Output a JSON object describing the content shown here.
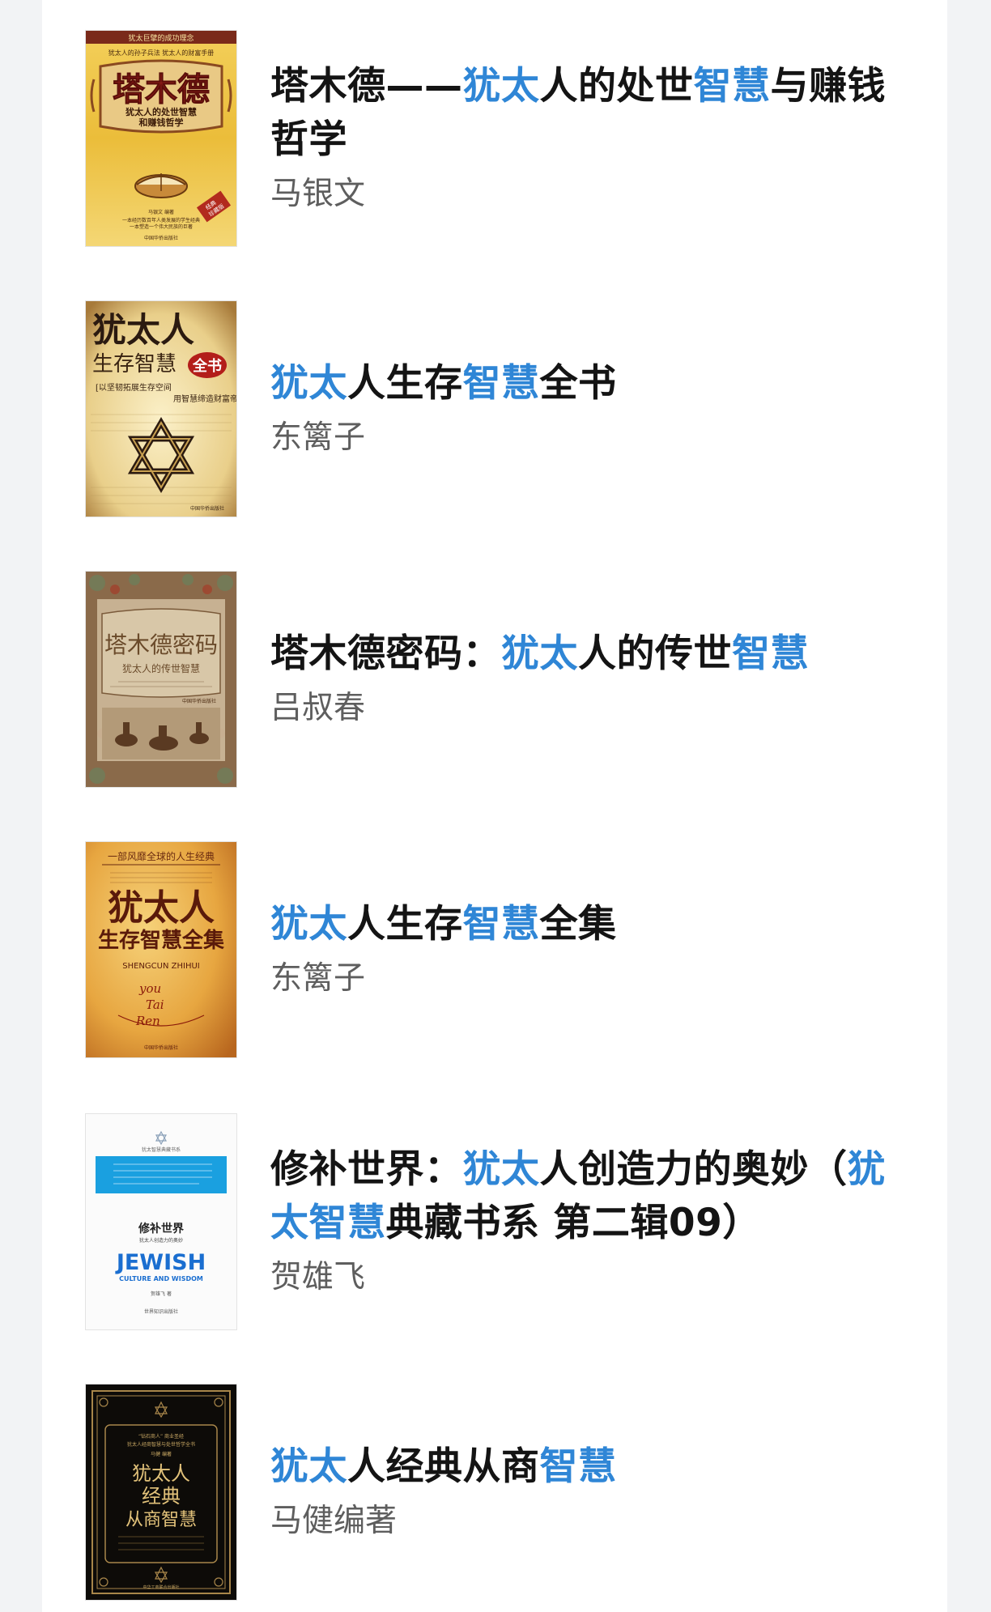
{
  "colors": {
    "highlight": "#2f86d6",
    "title": "#141414",
    "author": "#5e5e5e"
  },
  "results": [
    {
      "title_parts": [
        {
          "t": "塔木德——",
          "hl": false
        },
        {
          "t": "犹太",
          "hl": true
        },
        {
          "t": "人的处世",
          "hl": false
        },
        {
          "t": "智慧",
          "hl": true
        },
        {
          "t": "与赚钱哲学",
          "hl": false
        }
      ],
      "author": "马银文",
      "cover": {
        "top_line": "犹太巨擘的成功理念",
        "sub_line": "犹太人的孙子兵法  犹太人的财富手册",
        "main_title": "塔木德",
        "sub_title_1": "犹太人的处世智慧",
        "sub_title_2": "和赚钱哲学",
        "badge_1": "经典",
        "badge_2": "珍藏版",
        "author_line": "马银文 编著",
        "blurb_1": "一本经历数百年人类发展的学生经典",
        "blurb_2": "一本塑造一个伟大民族的巨著",
        "publisher": "中国华侨出版社"
      }
    },
    {
      "title_parts": [
        {
          "t": "犹太",
          "hl": true
        },
        {
          "t": "人生存",
          "hl": false
        },
        {
          "t": "智慧",
          "hl": true
        },
        {
          "t": "全书",
          "hl": false
        }
      ],
      "author": "东篱子",
      "cover": {
        "main_title": "犹太人",
        "line_2": "生存智慧",
        "badge": "全书",
        "quote_1": "[以坚韧拓展生存空间",
        "quote_2": "用智慧缔造财富帝国]",
        "publisher": "中国华侨出版社"
      }
    },
    {
      "title_parts": [
        {
          "t": "塔木德密码：",
          "hl": false
        },
        {
          "t": "犹太",
          "hl": true
        },
        {
          "t": "人的传世",
          "hl": false
        },
        {
          "t": "智慧",
          "hl": true
        }
      ],
      "author": "吕叔春",
      "cover": {
        "main_title": "塔木德密码",
        "sub_title": "犹太人的传世智慧",
        "publisher": "中国华侨出版社"
      }
    },
    {
      "title_parts": [
        {
          "t": "犹太",
          "hl": true
        },
        {
          "t": "人生存",
          "hl": false
        },
        {
          "t": "智慧",
          "hl": true
        },
        {
          "t": "全集",
          "hl": false
        }
      ],
      "author": "东篱子",
      "cover": {
        "top_line": "一部风靡全球的人生经典",
        "main_title": "犹太人",
        "line_2": "生存智慧全集",
        "pinyin": "SHENGCUN ZHIHUI",
        "script_1": "you",
        "script_2": "Tai",
        "script_3": "Ren",
        "publisher": "中国华侨出版社"
      }
    },
    {
      "title_parts": [
        {
          "t": "修补世界：",
          "hl": false
        },
        {
          "t": "犹太",
          "hl": true
        },
        {
          "t": "人创造力的奥妙（",
          "hl": false
        },
        {
          "t": "犹太智慧",
          "hl": true
        },
        {
          "t": "典藏书系 第二辑09）",
          "hl": false
        }
      ],
      "author": "贺雄飞",
      "cover": {
        "series": "犹太智慧典藏书系",
        "main_title": "修补世界",
        "sub_title": "犹太人创造力的奥妙",
        "en_1": "JEWISH",
        "en_2": "CULTURE AND WISDOM",
        "author_line": "贺雄飞 著",
        "publisher": "世界知识出版社"
      }
    },
    {
      "title_parts": [
        {
          "t": "犹太",
          "hl": true
        },
        {
          "t": "人经典从商",
          "hl": false
        },
        {
          "t": "智慧",
          "hl": true
        }
      ],
      "author": "马健编著",
      "cover": {
        "top_1": "“钻石商人” 商业圣经",
        "top_2": "犹太人经商智慧与处世哲学全书",
        "author_line": "马健 编著",
        "line_1": "犹太人",
        "line_2": "经典",
        "line_3": "从商智慧",
        "publisher": "中华工商联合出版社"
      }
    }
  ]
}
